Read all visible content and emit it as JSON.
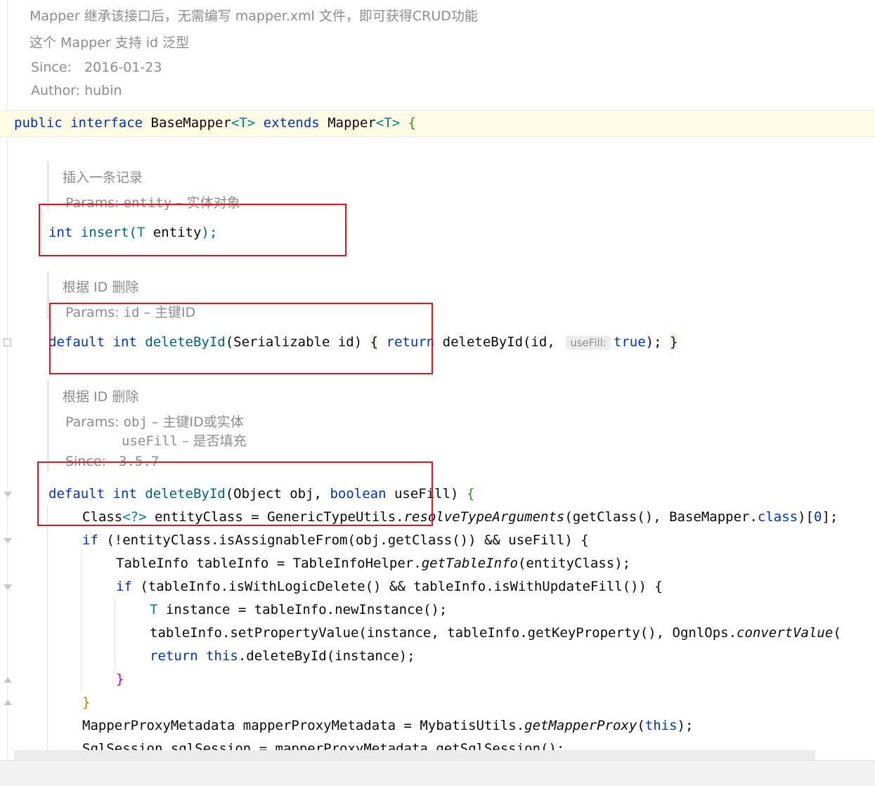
{
  "doc_top": {
    "line1": "Mapper 继承该接口后，无需编写 mapper.xml 文件，即可获得CRUD功能",
    "line2": "这个 Mapper 支持 id 泛型",
    "since_label": "Since:",
    "since_value": "2016-01-23",
    "author_label": "Author:",
    "author_value": "hubin"
  },
  "interface_decl": {
    "public": "public",
    "interface": "interface",
    "name": "BaseMapper",
    "generic1": "<T>",
    "extends": "extends",
    "parent": "Mapper",
    "generic2": "<T>",
    "brace": "{"
  },
  "insert_doc": {
    "title": "插入一条记录",
    "params_label": "Params:",
    "param_name": "entity",
    "param_desc": "– 实体对象"
  },
  "insert_method": {
    "ret": "int",
    "name": "insert",
    "open": "(",
    "type": "T",
    "arg": " entity",
    "close": ");"
  },
  "delete1_doc": {
    "title": "根据 ID 删除",
    "params_label": "Params:",
    "param_name": "id",
    "param_desc": "– 主键ID"
  },
  "delete1_method": {
    "default": "default",
    "ret": "int",
    "name": "deleteById",
    "sig": "(Serializable id)",
    "open_brace": "{",
    "return_kw": "return",
    "call": "deleteById(id,",
    "hint": "useFill:",
    "true_kw": "true",
    "end": ");",
    "close_brace": "}"
  },
  "delete2_doc": {
    "title": "根据 ID 删除",
    "params_label": "Params:",
    "param1_name": "obj",
    "param1_desc": "– 主键ID或实体",
    "param2_name": "useFill",
    "param2_desc": "– 是否填充",
    "since_label": "Since:",
    "since_value": "3.5.7"
  },
  "code_lines": {
    "l1_default": "default",
    "l1_int": "int",
    "l1_name": "deleteById",
    "l1_a": "(Object obj,",
    "l1_boolean": "boolean",
    "l1_b": "useFill)",
    "l1_brace": "{",
    "l2_a": "Class",
    "l2_b": "<?>",
    "l2_c": " entityClass = GenericTypeUtils.",
    "l2_d": "resolveTypeArguments",
    "l2_e": "(getClass(), BaseMapper.",
    "l2_f": "class",
    "l2_g": ")[",
    "l2_h": "0",
    "l2_i": "];",
    "l3_if": "if",
    "l3_rest": " (!entityClass.isAssignableFrom(obj.getClass()) && useFill) {",
    "l4_a": "TableInfo tableInfo = TableInfoHelper.",
    "l4_b": "getTableInfo",
    "l4_c": "(entityClass);",
    "l5_if": "if",
    "l5_rest": " (tableInfo.isWithLogicDelete() && tableInfo.isWithUpdateFill()) {",
    "l6_T": "T",
    "l6_rest": " instance = tableInfo.newInstance();",
    "l7_a": "tableInfo.setPropertyValue(instance, tableInfo.getKeyProperty(), OgnlOps.",
    "l7_b": "convertValue",
    "l7_c": "(",
    "l8_return": "return",
    "l8_this": "this",
    "l8_rest": ".deleteById(instance);",
    "l9": "}",
    "l10": "}",
    "l11_a": "MapperProxyMetadata mapperProxyMetadata = MybatisUtils.",
    "l11_b": "getMapperProxy",
    "l11_c": "(",
    "l11_this": "this",
    "l11_d": ");",
    "l12": "SqlSession sqlSession = mapperProxyMetadata.getSqlSession();"
  },
  "colors": {
    "keyword": "#0033b3",
    "method": "#00627a",
    "doc_text": "#8c8c8c",
    "highlight_box": "#e0141e"
  }
}
